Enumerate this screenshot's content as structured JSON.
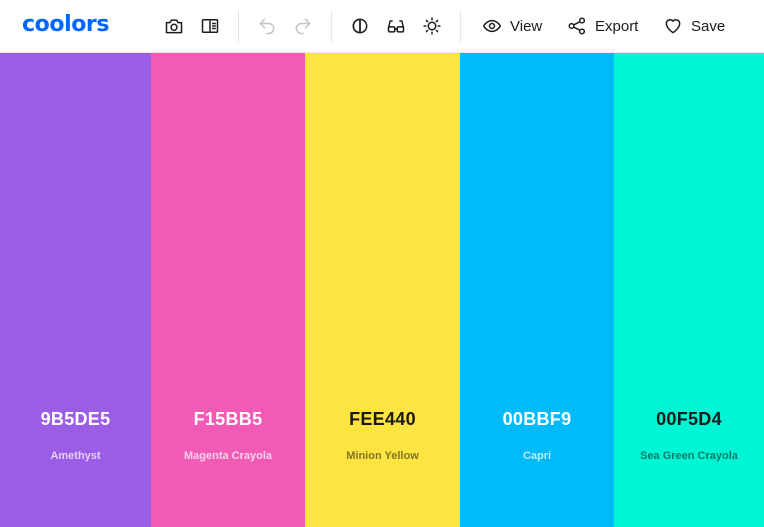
{
  "app": {
    "logo_text": "coolors",
    "brand_color": "#0066ff"
  },
  "toolbar": {
    "icons": [
      "camera-icon",
      "side-panel-icon",
      "undo-icon",
      "redo-icon",
      "contrast-icon",
      "glasses-icon",
      "brightness-icon"
    ],
    "view_label": "View",
    "export_label": "Export",
    "save_label": "Save"
  },
  "palette": {
    "colors": [
      {
        "hex": "9B5DE5",
        "name": "Amethyst",
        "value": "#9B5DE5"
      },
      {
        "hex": "F15BB5",
        "name": "Magenta Crayola",
        "value": "#F15BB5"
      },
      {
        "hex": "FEE440",
        "name": "Minion Yellow",
        "value": "#FEE440"
      },
      {
        "hex": "00BBF9",
        "name": "Capri",
        "value": "#00BBF9"
      },
      {
        "hex": "00F5D4",
        "name": "Sea Green Crayola",
        "value": "#00F5D4"
      }
    ]
  }
}
